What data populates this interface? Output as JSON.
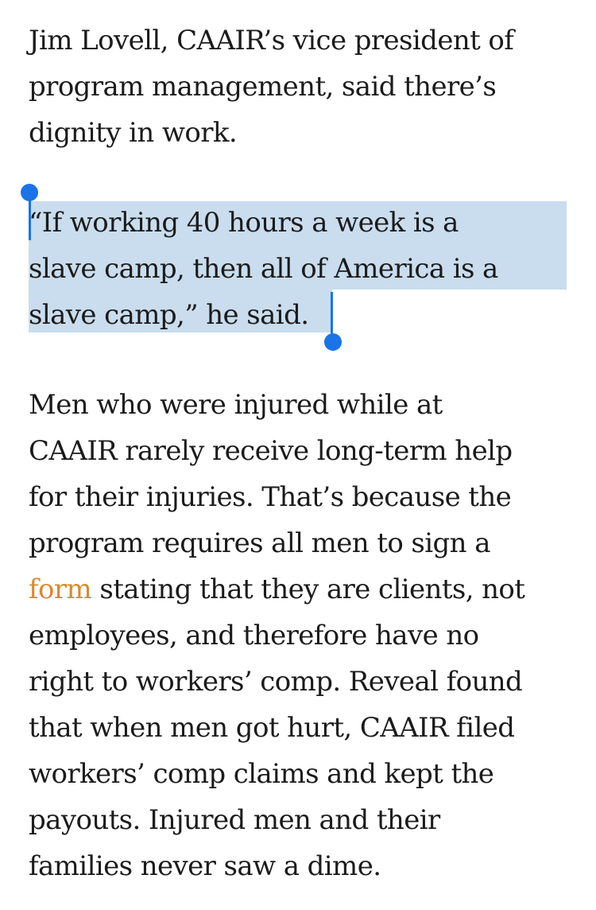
{
  "article": {
    "p1": {
      "lines": [
        "Jim Lovell, CAAIR’s vice president of",
        "program management, said there’s",
        "dignity in work."
      ]
    },
    "p2": {
      "lines": [
        "“If working 40 hours a week is a",
        "slave camp, then all of America is a",
        "slave camp,” he said."
      ],
      "selected": true
    },
    "p3": {
      "lines": [
        "Men who were injured while at",
        "CAAIR rarely receive long-term help",
        "for their injuries. That’s because the",
        "program requires all men to sign a"
      ],
      "link_text": "form",
      "line5_rest": " stating that they are clients, not",
      "lines_after": [
        "employees, and therefore have no",
        "right to workers’ comp. Reveal found",
        "that when men got hurt, CAAIR filed",
        "workers’ comp claims and kept the",
        "payouts. Injured men and their",
        "families never saw a dime."
      ]
    }
  },
  "colors": {
    "text": "#1b1b1b",
    "link": "#d98a2b",
    "selection": "#c9ddee",
    "selection_handle": "#1a73e8"
  }
}
